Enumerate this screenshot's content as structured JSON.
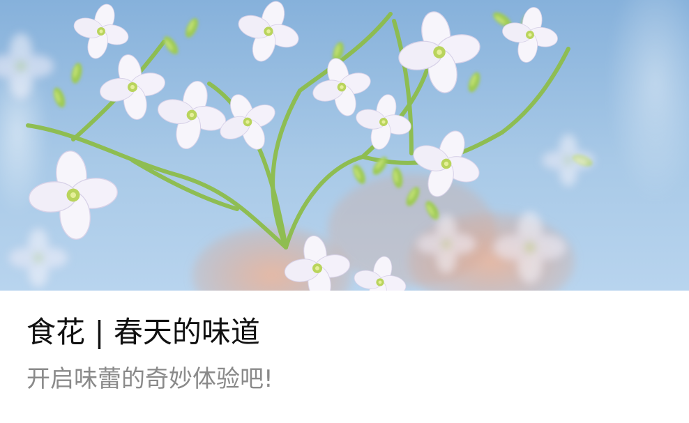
{
  "hero": {
    "image": "white-flower-blossoms-photo"
  },
  "content": {
    "title": "食花 | 春天的味道",
    "subtitle": "开启味蕾的奇妙体验吧!"
  },
  "colors": {
    "sky": "#a9cbe9",
    "petal": "#f6f3fb",
    "stem": "#8db64b",
    "title_text": "#111111",
    "subtitle_text": "#8a8a8a",
    "card_background": "#ffffff"
  }
}
